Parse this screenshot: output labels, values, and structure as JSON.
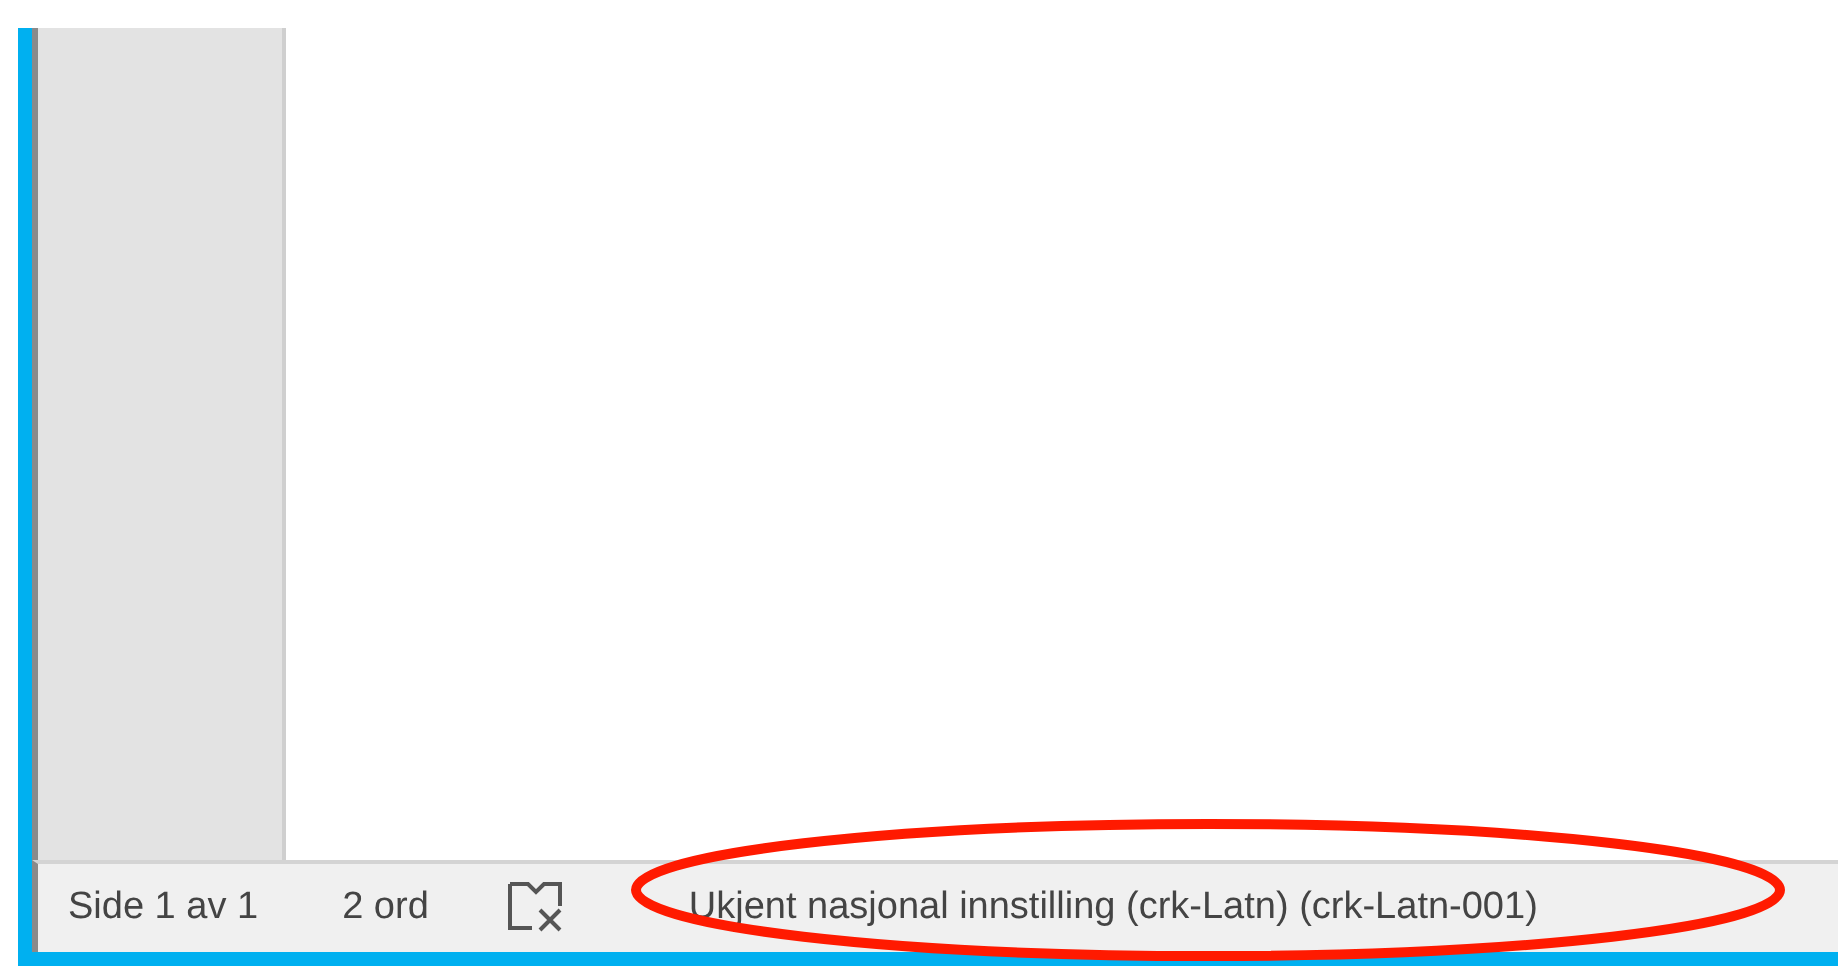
{
  "status_bar": {
    "page": "Side 1 av 1",
    "words": "2 ord",
    "language": "Ukjent nasjonal innstilling (crk-Latn) (crk-Latn-001)"
  }
}
